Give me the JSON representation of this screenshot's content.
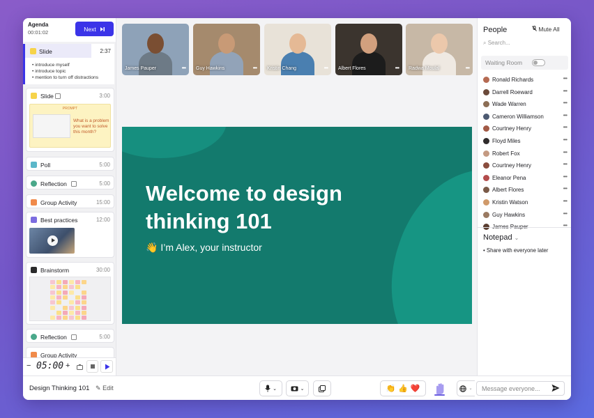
{
  "agenda": {
    "title": "Agenda",
    "elapsed": "00:01:02",
    "next_label": "Next",
    "items": [
      {
        "label": "Slide",
        "duration": "2:37",
        "bullets": [
          "introduce myself",
          "introduce topic",
          "mention to turn off distractions"
        ]
      },
      {
        "label": "Slide",
        "duration": "3:00",
        "prompt_title": "PROMPT",
        "prompt_text": "What is a problem you want to solve this month?"
      },
      {
        "label": "Poll",
        "duration": "5:00"
      },
      {
        "label": "Reflection",
        "duration": "5:00"
      },
      {
        "label": "Group Activity",
        "duration": "15:00"
      },
      {
        "label": "Best practices",
        "duration": "12:00"
      },
      {
        "label": "Brainstorm",
        "duration": "30:00"
      },
      {
        "label": "Reflection",
        "duration": "5:00"
      },
      {
        "label": "Group Activity",
        "duration": ""
      }
    ],
    "timer_value": "05:00"
  },
  "videos": [
    {
      "name": "James Pauper",
      "bg": "#8ea2b8",
      "skin": "#7a4e32",
      "shirt": "#6d7a86"
    },
    {
      "name": "Guy Hawkins",
      "bg": "#a58a6d",
      "skin": "#c89a76",
      "shirt": "#92a3b8"
    },
    {
      "name": "Kristin Chang",
      "bg": "#e8e2d8",
      "skin": "#e5b995",
      "shirt": "#4a7fb0"
    },
    {
      "name": "Albert Flores",
      "bg": "#3b342e",
      "skin": "#d2a07e",
      "shirt": "#1c1c1c"
    },
    {
      "name": "Radwa Moulal",
      "bg": "#c7b8a6",
      "skin": "#ecc8ab",
      "shirt": "#efe9e2"
    }
  ],
  "slide": {
    "title": "Welcome to design thinking 101",
    "subtitle": "👋 I’m Alex, your instructor"
  },
  "people": {
    "title": "People",
    "mute_all": "Mute All",
    "search_placeholder": "Search...",
    "waiting_room": "Waiting Room",
    "list": [
      {
        "name": "Ronald Richards",
        "color": "#b56a52"
      },
      {
        "name": "Darrell Roeward",
        "color": "#6b4a3a"
      },
      {
        "name": "Wade Warren",
        "color": "#8c6e55"
      },
      {
        "name": "Cameron Williamson",
        "color": "#4d5a72"
      },
      {
        "name": "Courtney Henry",
        "color": "#a25a46"
      },
      {
        "name": "Floyd Miles",
        "color": "#2f2b2b"
      },
      {
        "name": "Robert Fox",
        "color": "#c49a82"
      },
      {
        "name": "Courtney Henry",
        "color": "#8a4d3e"
      },
      {
        "name": "Eleanor Pena",
        "color": "#b34c4c"
      },
      {
        "name": "Albert Flores",
        "color": "#7a5a48"
      },
      {
        "name": "Kristin Watson",
        "color": "#d09a6a"
      },
      {
        "name": "Guy Hawkins",
        "color": "#9a7a62"
      },
      {
        "name": "James Pauper",
        "color": "#5a3e30"
      }
    ]
  },
  "notepad": {
    "title": "Notepad",
    "item": "Share with everyone later"
  },
  "bottom": {
    "session_title": "Design Thinking 101",
    "edit_label": "Edit",
    "reactions": [
      "👏",
      "👍",
      "❤️"
    ],
    "message_placeholder": "Message everyone..."
  }
}
